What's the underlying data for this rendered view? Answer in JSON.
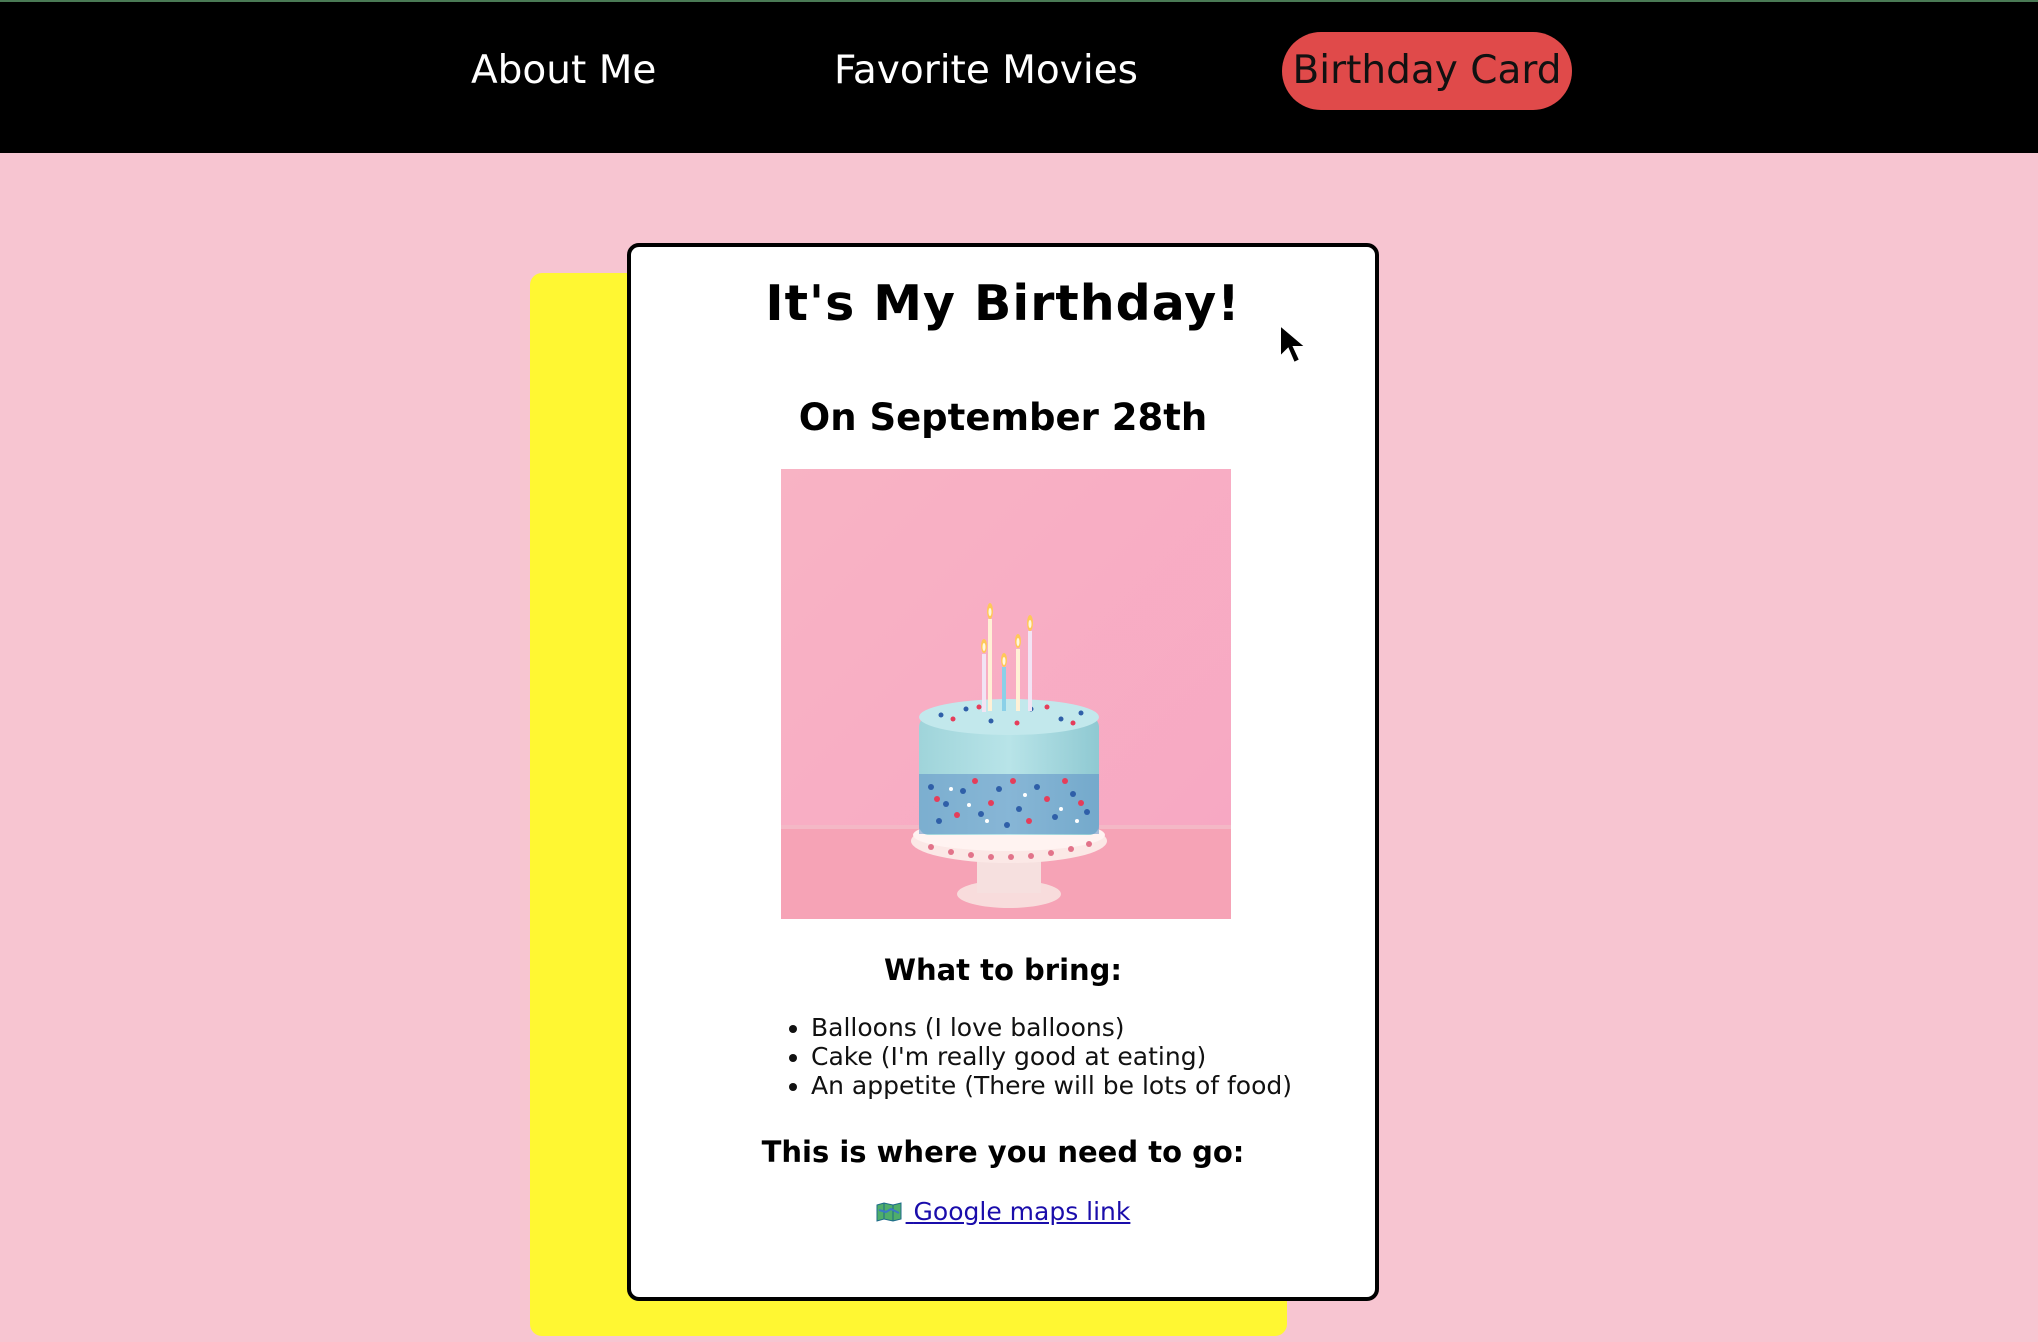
{
  "nav": {
    "about": "About Me",
    "movies": "Favorite Movies",
    "birthday": "Birthday Card"
  },
  "card": {
    "title": "It's My Birthday!",
    "date": "On September 28th",
    "image_subject": "birthday-cake-with-candles",
    "bring_heading": "What to bring:",
    "bring_items": [
      "Balloons (I love balloons)",
      "Cake (I'm really good at eating)",
      "An appetite (There will be lots of food)"
    ],
    "go_heading": "This is where you need to go:",
    "map_icon": "map-icon",
    "map_link": "Google maps link"
  },
  "colors": {
    "background": "#f7c5d1",
    "nav_background": "#000000",
    "active_pill": "#e04a4a",
    "shadow_card": "#fff732",
    "link": "#1a0dab"
  }
}
